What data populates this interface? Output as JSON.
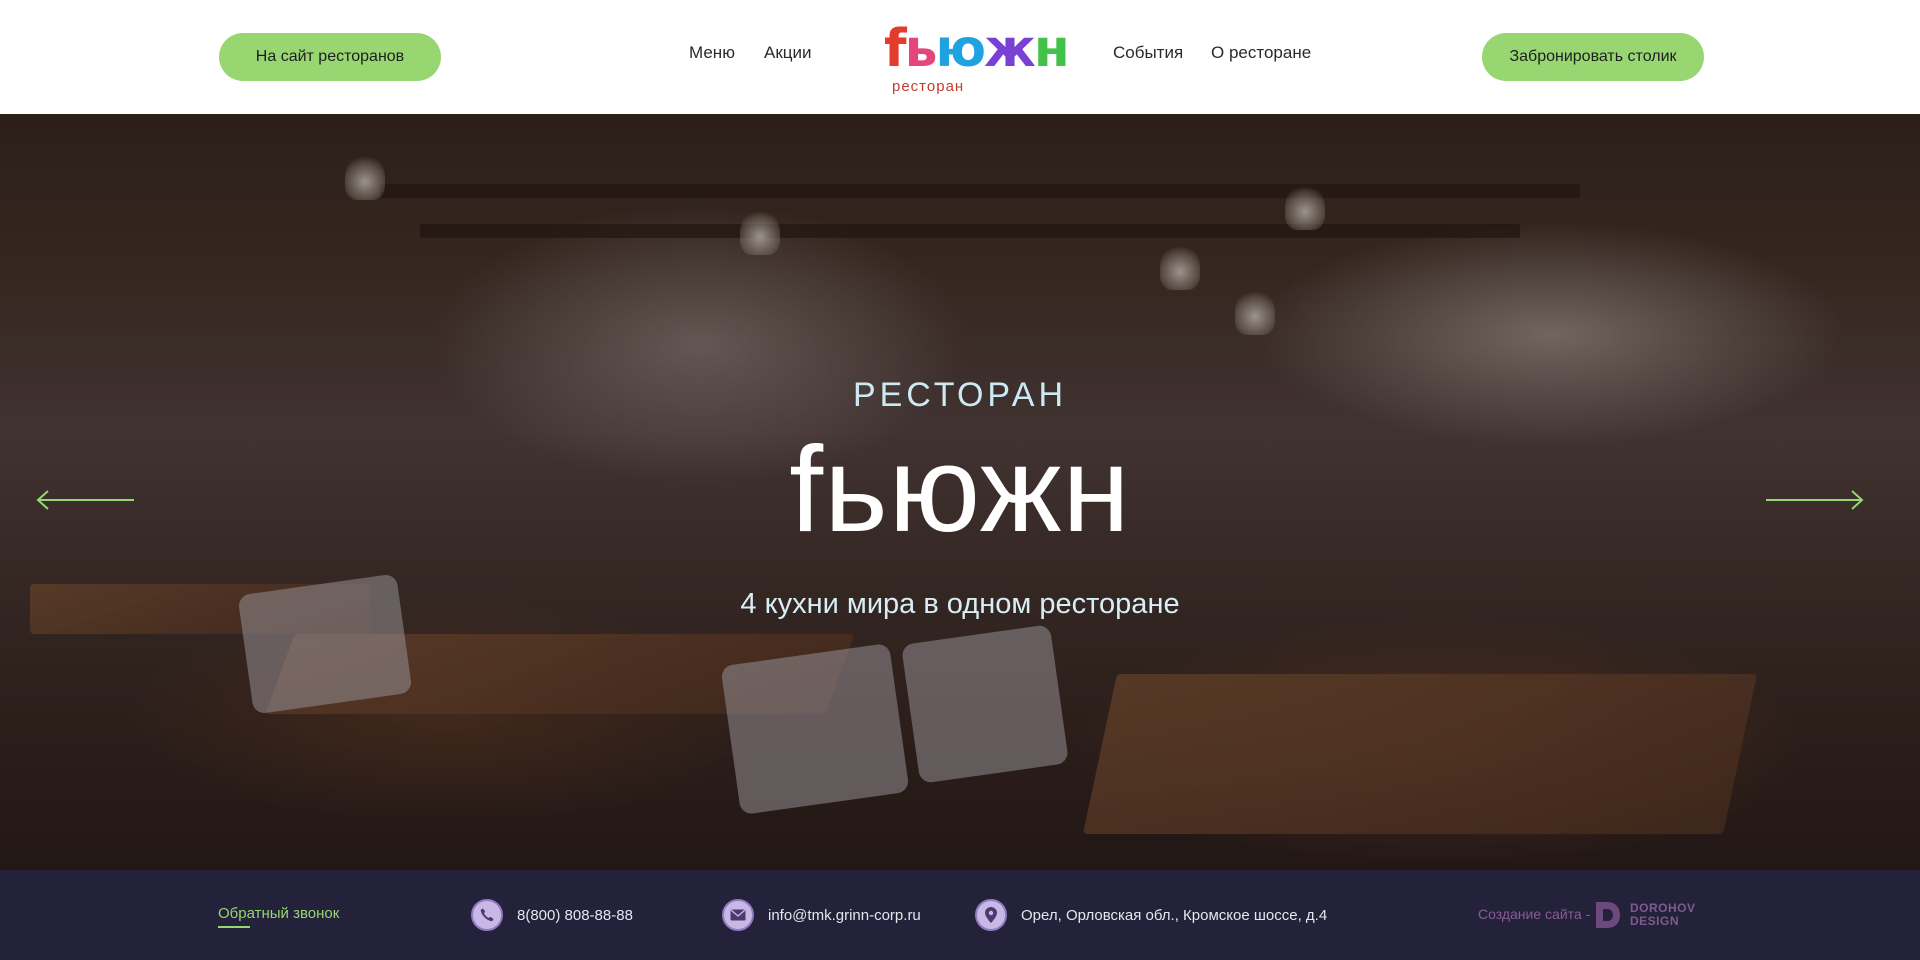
{
  "header": {
    "left_button": "На сайт ресторанов",
    "nav_left": [
      {
        "label": "Меню"
      },
      {
        "label": "Акции"
      }
    ],
    "logo": {
      "word": "fьюжн",
      "subtitle": "ресторан"
    },
    "nav_right": [
      {
        "label": "События"
      },
      {
        "label": "О ресторане"
      }
    ],
    "right_button": "Забронировать столик"
  },
  "hero": {
    "kicker": "РЕСТОРАН",
    "title": "fьюжн",
    "tagline": "4 кухни мира в одном ресторане"
  },
  "footer": {
    "callback": "Обратный звонок",
    "phone": "8(800) 808-88-88",
    "email": "info@tmk.grinn-corp.ru",
    "address": "Орел, Орловская обл., Кромское шоссе, д.4",
    "made_by": "Создание сайта -",
    "developer": {
      "line1": "DOROHOV",
      "line2": "DESIGN"
    }
  },
  "colors": {
    "accent_green": "#98d672",
    "footer_bg": "#23223a",
    "icon_bg": "#c9b8e6"
  },
  "icons": [
    "phone-icon",
    "mail-icon",
    "location-pin-icon",
    "arrow-left-icon",
    "arrow-right-icon"
  ]
}
